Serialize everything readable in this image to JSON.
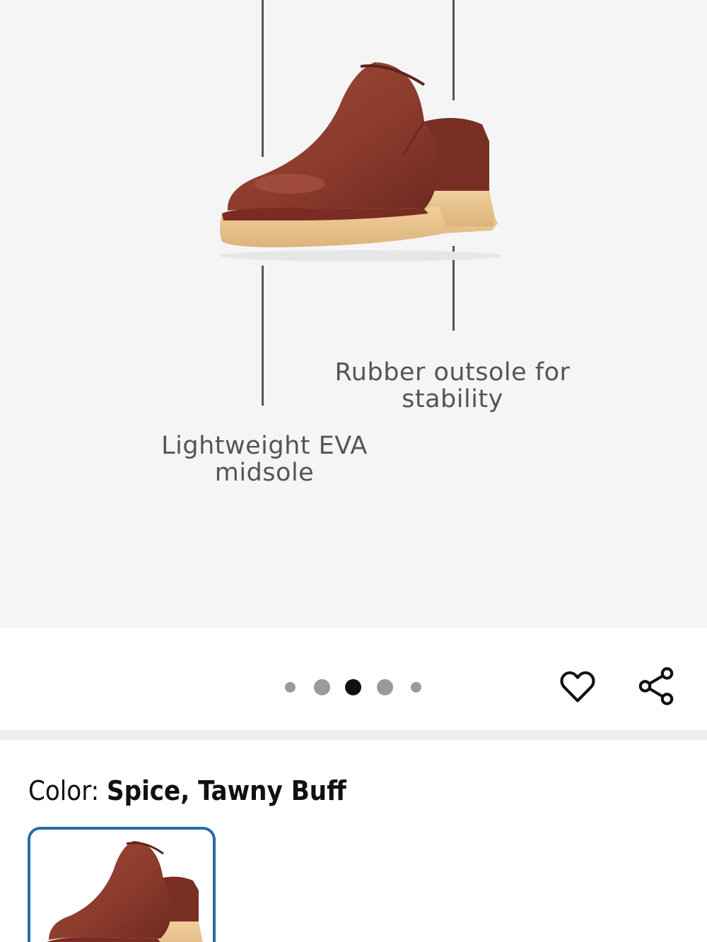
{
  "hero": {
    "callout_midsole": "Lightweight EVA midsole",
    "callout_midsole_line1": "Lightweight EVA",
    "callout_midsole_line2": "midsole",
    "callout_outsole_line1": "Rubber outsole for",
    "callout_outsole_line2": "stability"
  },
  "carousel": {
    "current_index": 3,
    "total": 5
  },
  "actions": {
    "favorite_icon": "heart-outline-icon",
    "share_icon": "share-icon"
  },
  "color": {
    "label": "Color: ",
    "value": "Spice, Tawny Buff"
  },
  "colors": {
    "shoe_leather": "#8a3a2c",
    "shoe_sole": "#e9c48c",
    "selected_border": "#2a6ba3",
    "dot_active": "#111111",
    "dot_inactive": "#9a9a9a"
  }
}
